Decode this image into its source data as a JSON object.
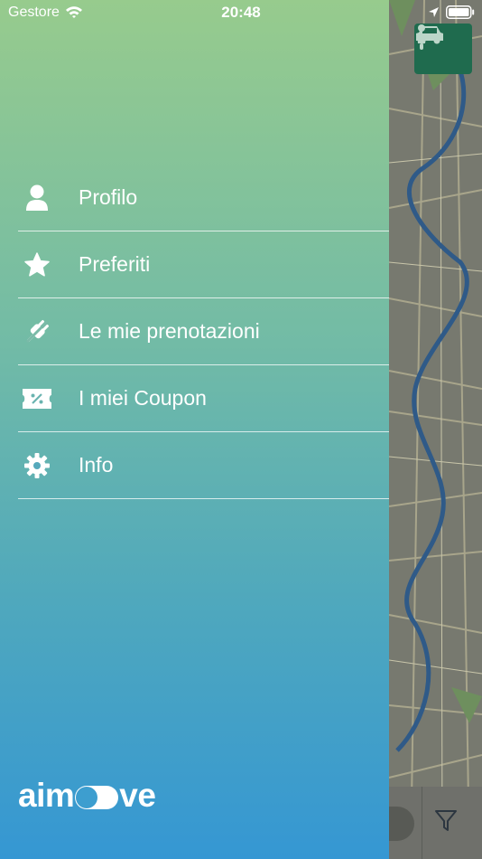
{
  "status_bar": {
    "carrier": "Gestore",
    "time": "20:48"
  },
  "menu": {
    "items": [
      {
        "label": "Profilo",
        "icon": "user-icon"
      },
      {
        "label": "Preferiti",
        "icon": "star-icon"
      },
      {
        "label": "Le mie prenotazioni",
        "icon": "plug-icon"
      },
      {
        "label": "I miei Coupon",
        "icon": "coupon-icon"
      },
      {
        "label": "Info",
        "icon": "gear-icon"
      }
    ]
  },
  "brand": {
    "logo_start": "aim",
    "logo_end": "ve"
  },
  "colors": {
    "gradient_top": "#97cb8d",
    "gradient_bottom": "#3597d3",
    "vehicle_toggle": "#1f6b4e"
  }
}
